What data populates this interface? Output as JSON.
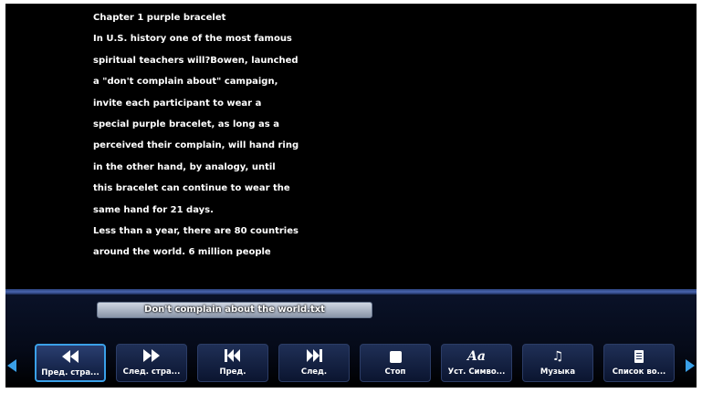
{
  "reader": {
    "lines": [
      "Chapter 1 purple bracelet",
      "In U.S. history one of the most famous",
      "spiritual teachers will?Bowen, launched",
      "a \"don't complain about\" campaign,",
      "invite each participant to wear a",
      "special purple bracelet, as long as a",
      "perceived their complain, will hand ring",
      "in the other hand, by analogy, until",
      "this bracelet can continue to wear the",
      "same hand for 21 days.",
      "Less than a year, there are 80 countries",
      "around the world. 6 million people"
    ]
  },
  "file": {
    "name": "Don't complain about the world.txt"
  },
  "toolbar": {
    "buttons": [
      {
        "label": "Пред. стра...",
        "icon": "rewind-icon"
      },
      {
        "label": "След. стра...",
        "icon": "fast-forward-icon"
      },
      {
        "label": "Пред.",
        "icon": "skip-previous-icon"
      },
      {
        "label": "След.",
        "icon": "skip-next-icon"
      },
      {
        "label": "Стоп",
        "icon": "stop-icon"
      },
      {
        "label": "Уст. Симво...",
        "icon": "font-icon"
      },
      {
        "label": "Музыка",
        "icon": "music-note-icon"
      },
      {
        "label": "Список во...",
        "icon": "document-list-icon"
      }
    ]
  },
  "colors": {
    "accent": "#3aa0e8",
    "background": "#000000"
  }
}
